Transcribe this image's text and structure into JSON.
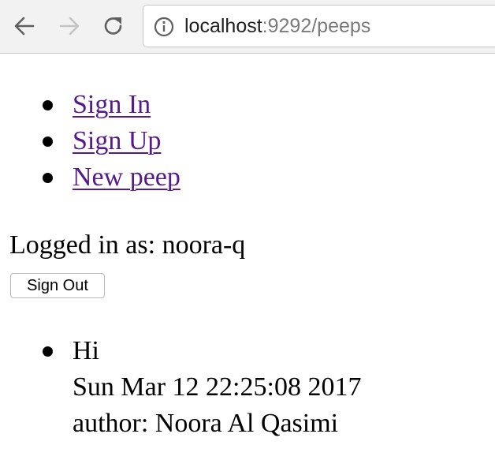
{
  "browser": {
    "url_host": "localhost",
    "url_rest": ":9292/peeps"
  },
  "nav": {
    "items": [
      {
        "label": "Sign In"
      },
      {
        "label": "Sign Up"
      },
      {
        "label": "New peep"
      }
    ]
  },
  "session": {
    "logged_in_text": "Logged in as: noora-q",
    "sign_out_label": "Sign Out"
  },
  "peeps": [
    {
      "message": "Hi",
      "timestamp": "Sun Mar 12 22:25:08 2017",
      "author": "author: Noora Al Qasimi"
    }
  ],
  "colors": {
    "link_visited": "#551a8b",
    "toolbar_bg": "#f2f2f2"
  }
}
